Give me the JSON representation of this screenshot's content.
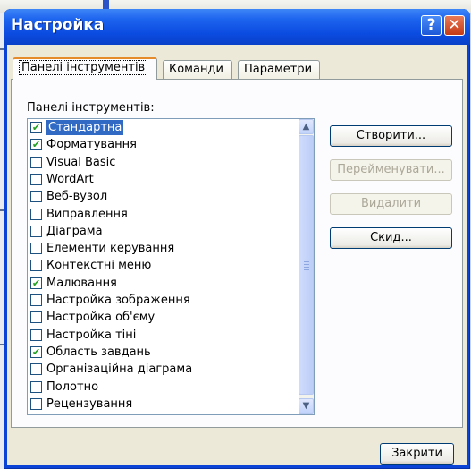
{
  "dialog": {
    "title": "Настройка",
    "help_glyph": "?",
    "close_glyph": "✕"
  },
  "tabs": [
    {
      "label": "Панелі інструментів",
      "active": true
    },
    {
      "label": "Команди",
      "active": false
    },
    {
      "label": "Параметри",
      "active": false
    }
  ],
  "toolbars": {
    "label": "Панелі інструментів:",
    "items": [
      {
        "label": "Стандартна",
        "checked": true,
        "selected": true
      },
      {
        "label": "Форматування",
        "checked": true,
        "selected": false
      },
      {
        "label": "Visual Basic",
        "checked": false,
        "selected": false
      },
      {
        "label": "WordArt",
        "checked": false,
        "selected": false
      },
      {
        "label": "Веб-вузол",
        "checked": false,
        "selected": false
      },
      {
        "label": "Виправлення",
        "checked": false,
        "selected": false
      },
      {
        "label": "Діаграма",
        "checked": false,
        "selected": false
      },
      {
        "label": "Елементи керування",
        "checked": false,
        "selected": false
      },
      {
        "label": "Контекстні меню",
        "checked": false,
        "selected": false
      },
      {
        "label": "Малювання",
        "checked": true,
        "selected": false
      },
      {
        "label": "Настройка зображення",
        "checked": false,
        "selected": false
      },
      {
        "label": "Настройка об'єму",
        "checked": false,
        "selected": false
      },
      {
        "label": "Настройка тіні",
        "checked": false,
        "selected": false
      },
      {
        "label": "Область завдань",
        "checked": true,
        "selected": false
      },
      {
        "label": "Організаційна діаграма",
        "checked": false,
        "selected": false
      },
      {
        "label": "Полотно",
        "checked": false,
        "selected": false
      },
      {
        "label": "Рецензування",
        "checked": false,
        "selected": false
      }
    ]
  },
  "buttons": {
    "create": "Створити...",
    "rename": "Перейменувати...",
    "delete": "Видалити",
    "reset": "Скид...",
    "close": "Закрити"
  },
  "scroll": {
    "up_glyph": "▲",
    "down_glyph": "▼"
  },
  "colors": {
    "title_blue": "#0a43d6",
    "selection": "#316ac5",
    "check_green": "#21a121"
  }
}
